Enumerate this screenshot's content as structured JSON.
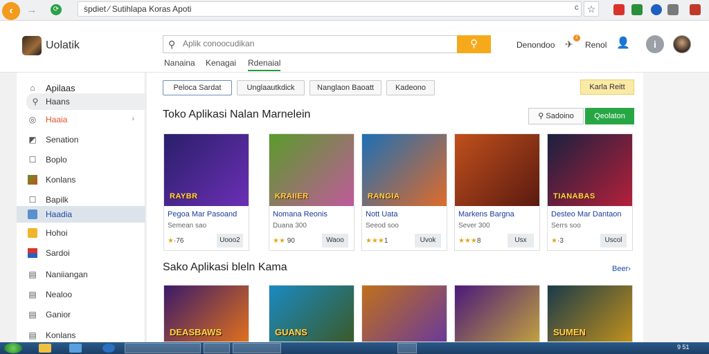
{
  "browser": {
    "url": "ṡpdiet ⁄ Sutihlapa Koras Apoti",
    "url_suffix": "c",
    "back_label": "‹",
    "forward_label": "→",
    "star_label": "☆"
  },
  "header": {
    "logo_text": "Uolatik",
    "search_placeholder": "Aplik conoocudikan",
    "search_value": "",
    "search_button_icon": "search-icon",
    "sub_tabs": [
      "Nanaina",
      "Kenagai",
      "Rdenaial"
    ],
    "link1": "Denondoo",
    "notif_count": "2",
    "link2": "Renol",
    "info_label": "i"
  },
  "sidebar": {
    "items": [
      {
        "label": "Apilaas",
        "icon": "home-icon"
      },
      {
        "label": "Haans",
        "icon": "search-icon"
      },
      {
        "label": "Haaia",
        "icon": "target-icon",
        "chevron": "›"
      },
      {
        "label": "Senation",
        "icon": "chart-icon"
      },
      {
        "label": "Boplo",
        "icon": "square-icon"
      },
      {
        "label": "Konlans",
        "icon": "game-icon"
      },
      {
        "label": "Bapilk",
        "icon": "square-icon"
      },
      {
        "label": "Haadia",
        "icon": "folder-icon"
      },
      {
        "label": "Hohoi",
        "icon": "folder-icon"
      },
      {
        "label": "Sardoi",
        "icon": "flag-icon"
      },
      {
        "label": "Naniiangan",
        "icon": "doc-icon"
      },
      {
        "label": "Nealoo",
        "icon": "doc-icon"
      },
      {
        "label": "Ganior",
        "icon": "doc-icon"
      },
      {
        "label": "Konlans",
        "icon": "doc-icon"
      }
    ]
  },
  "main": {
    "chips": [
      "Peloca Sardat",
      "Unglaautkdick",
      "Nanglaon Baoatt",
      "Kadeono"
    ],
    "chip_right": "Karla Reitt",
    "section1_title": "Toko Aplikasi Nalan Marnelein",
    "filter_label": "Sadoino",
    "green_button": "Qeolaton",
    "cards": [
      {
        "title": "Pegoa Mar Pasoand",
        "sub": "Semean sao",
        "rating": "76",
        "button": "Uooo2",
        "image_text": "RAYBR",
        "bg": [
          "#2a1f6a",
          "#6b2fb5"
        ]
      },
      {
        "title": "Nomana Reonis",
        "sub": "Duana 300",
        "rating": "90",
        "button": "Waoo",
        "image_text": "KRAIIER",
        "bg": [
          "#5a9b2a",
          "#c05a9c"
        ]
      },
      {
        "title": "Nott Uata",
        "sub": "Seeod soo",
        "rating": "1",
        "button": "Uvok",
        "image_text": "RANGIA",
        "bg": [
          "#1c6fb5",
          "#e06b2a"
        ]
      },
      {
        "title": "Markens Bargna",
        "sub": "Sever 300",
        "rating": "8",
        "button": "Usx",
        "image_text": "",
        "bg": [
          "#c0501c",
          "#5a1a10"
        ]
      },
      {
        "title": "Desteo Mar Dantaon",
        "sub": "Serrs soo",
        "rating": "3",
        "button": "Uscol",
        "image_text": "TIANABAS",
        "bg": [
          "#1a2040",
          "#b5203a"
        ]
      }
    ],
    "section2_title": "Sako Aplikasi bleln Kama",
    "more_link": "Beer›",
    "cards2": [
      {
        "image_text": "DEASBAWS",
        "bg": [
          "#3a1a6a",
          "#e0701c"
        ]
      },
      {
        "image_text": "GUANS",
        "bg": [
          "#1a8ac0",
          "#3a5a2a"
        ]
      },
      {
        "image_text": "",
        "bg": [
          "#c0701c",
          "#6a3a9a"
        ]
      },
      {
        "image_text": "",
        "bg": [
          "#4a1a7a",
          "#c0a040"
        ]
      },
      {
        "image_text": "SUMEN",
        "bg": [
          "#1a3a4a",
          "#c0901c"
        ]
      }
    ]
  },
  "taskbar": {
    "clock": "9 51"
  },
  "colors": {
    "accent": "#f5a91b",
    "green": "#27a744",
    "link": "#1a3a9a"
  }
}
